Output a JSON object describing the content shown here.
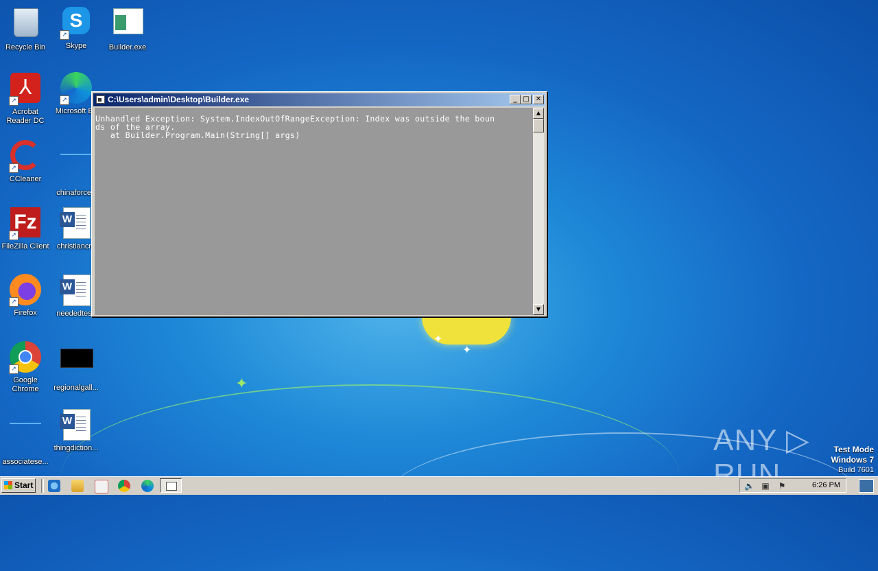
{
  "desktop": {
    "icons": [
      {
        "label": "Recycle Bin"
      },
      {
        "label": "Skype"
      },
      {
        "label": "Builder.exe"
      },
      {
        "label": "Acrobat Reader DC"
      },
      {
        "label": "Microsoft Ec"
      },
      {
        "label": "CCleaner"
      },
      {
        "label": "chinaforce.r"
      },
      {
        "label": "FileZilla Client"
      },
      {
        "label": "christiancro"
      },
      {
        "label": "Firefox"
      },
      {
        "label": "neededtest."
      },
      {
        "label": "Google Chrome"
      },
      {
        "label": "regionalgall..."
      },
      {
        "label": "associatese..."
      },
      {
        "label": "thingdiction..."
      }
    ]
  },
  "window": {
    "title": "C:\\Users\\admin\\Desktop\\Builder.exe",
    "minimize_glyph": "_",
    "maximize_glyph": "□",
    "close_glyph": "✕",
    "console_text": "Unhandled Exception: System.IndexOutOfRangeException: Index was outside the boun\nds of the array.\n   at Builder.Program.Main(String[] args)"
  },
  "watermark": {
    "text": "ANY ▷ RUN"
  },
  "os_info": {
    "line1": "Test Mode",
    "line2": "Windows 7",
    "line3": "Build 7601"
  },
  "taskbar": {
    "start_label": "Start",
    "clock": "6:26 PM"
  }
}
